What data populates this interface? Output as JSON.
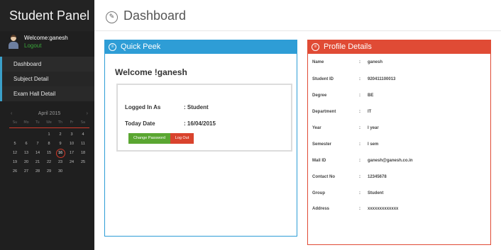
{
  "sidebar": {
    "title": "Student Panel",
    "welcome": "Welcome:ganesh",
    "logout": "Logout",
    "nav": [
      "Dashboard",
      "Subject Detail",
      "Exam Hall Detail"
    ],
    "calendar": {
      "month": "April 2015",
      "prev": "‹",
      "next": "›",
      "weekdays": [
        "Su",
        "Mo",
        "Tu",
        "We",
        "Th",
        "Fr",
        "Sa"
      ],
      "leading_blanks": 3,
      "days": [
        1,
        2,
        3,
        4,
        5,
        6,
        7,
        8,
        9,
        10,
        11,
        12,
        13,
        14,
        15,
        16,
        17,
        18,
        19,
        20,
        21,
        22,
        23,
        24,
        25,
        26,
        27,
        28,
        29,
        30
      ],
      "today": 16
    }
  },
  "header": {
    "title": "Dashboard"
  },
  "quick_peek": {
    "title": "Quick Peek",
    "welcome": "Welcome !ganesh",
    "logged_in_label": "Logged In As",
    "logged_in_value": ": Student",
    "date_label": "Today Date",
    "date_value": ": 16/04/2015",
    "change_password": "Change Password",
    "log_out": "Log Out"
  },
  "profile": {
    "title": "Profile Details",
    "rows": [
      {
        "label": "Name",
        "sep": ":",
        "value": "ganesh"
      },
      {
        "label": "Student ID",
        "sep": ":",
        "value": "920411100013"
      },
      {
        "label": "Degree",
        "sep": ":",
        "value": "BE"
      },
      {
        "label": "Department",
        "sep": ":",
        "value": "IT"
      },
      {
        "label": "Year",
        "sep": ":",
        "value": "I year"
      },
      {
        "label": "Semester",
        "sep": ":",
        "value": "I sem"
      },
      {
        "label": "Mail ID",
        "sep": ":",
        "value": "ganesh@ganesh.co.in"
      },
      {
        "label": "Contact No",
        "sep": ":",
        "value": "12345678"
      },
      {
        "label": "Group",
        "sep": ":",
        "value": "Student"
      },
      {
        "label": "Address",
        "sep": ":",
        "value": "xxxxxxxxxxxxx"
      }
    ]
  },
  "colors": {
    "sidebar_bg": "#1f1f1f",
    "quick_peek_accent": "#2e9dd6",
    "profile_accent": "#e04b35",
    "change_password_btn": "#5aa631",
    "log_out_btn": "#d9432d",
    "logout_link": "#3aa63a"
  }
}
